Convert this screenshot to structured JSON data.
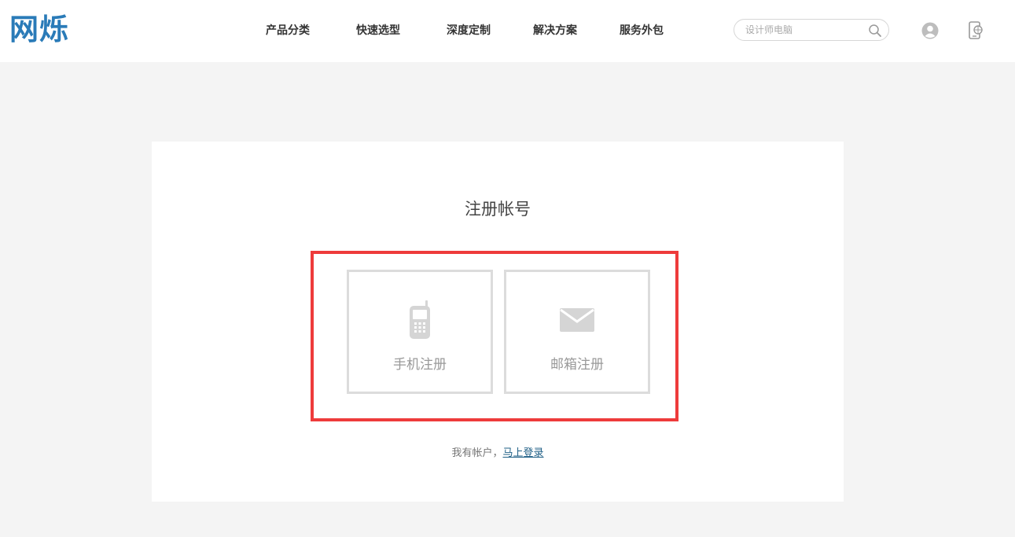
{
  "header": {
    "logo_text": "网烁",
    "nav": [
      {
        "label": "产品分类"
      },
      {
        "label": "快速选型"
      },
      {
        "label": "深度定制"
      },
      {
        "label": "解决方案"
      },
      {
        "label": "服务外包"
      }
    ],
    "search": {
      "placeholder": "设计师电脑",
      "icon": "search-icon"
    },
    "user_icon": "user-icon",
    "device_icon": "device-icon"
  },
  "register": {
    "title": "注册帐号",
    "options": [
      {
        "label": "手机注册",
        "icon": "mobile-phone-icon"
      },
      {
        "label": "邮箱注册",
        "icon": "envelope-icon"
      }
    ],
    "login_prompt": "我有帐户，",
    "login_link": "马上登录"
  },
  "colors": {
    "logo": "#2a7bb8",
    "highlight": "#ee3b3b",
    "link": "#1f5f86",
    "background": "#f4f4f4"
  }
}
